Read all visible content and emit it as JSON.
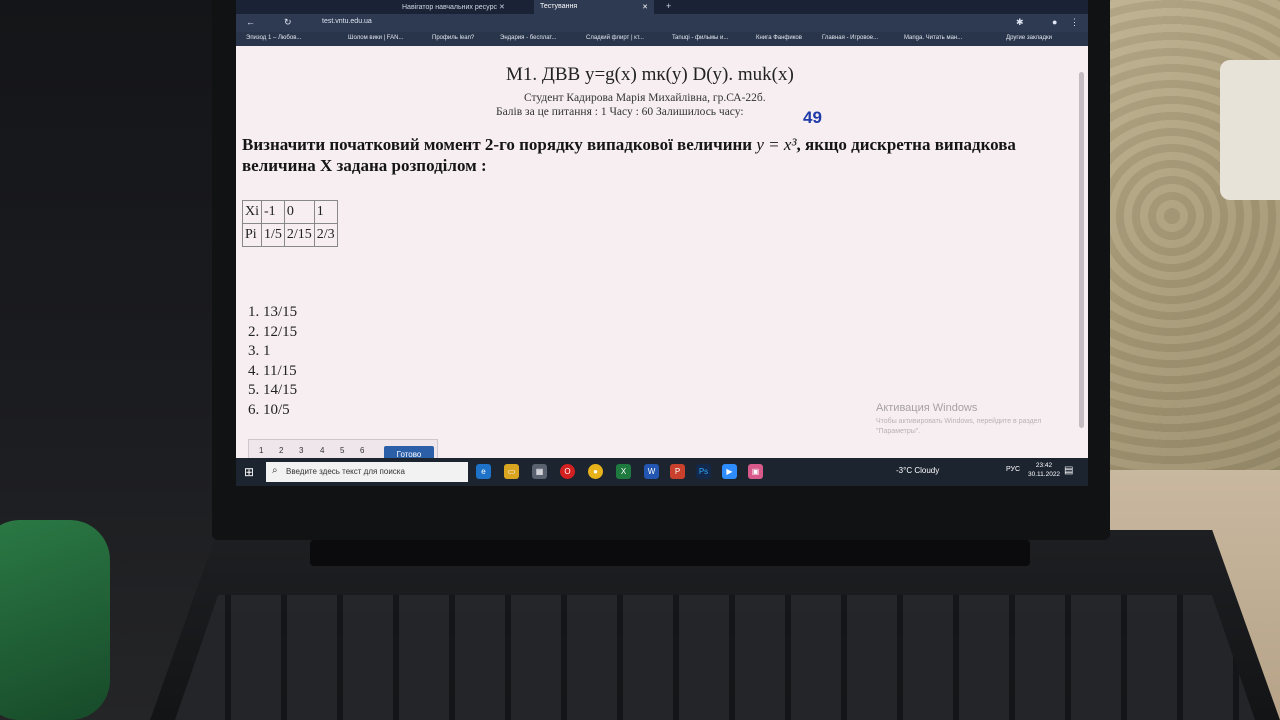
{
  "browser": {
    "tabs": [
      {
        "label": "Навігатор навчальних ресурс"
      },
      {
        "label": "Тестування"
      }
    ],
    "new_tab_symbol": "+",
    "url": "test.vntu.edu.ua",
    "bookmarks": [
      "Эпизод 1 – Любов...",
      "Шолом вики | FAN...",
      "Профиль lean?",
      "Эндария - бесплат...",
      "Сладкий флирт | кт...",
      "Tanuqi - фильмы и...",
      "Книга Фанфиков",
      "Главная - Игровое...",
      "Manga. Читать ман...",
      "Другие закладки"
    ]
  },
  "test": {
    "title": "М1. ДВВ y=g(x) mк(y) D(y). muk(x)",
    "student": "Студент Кадирова Марія Михайлівна, гр.СА-22б.",
    "time_line": "Балів за це питання : 1 Часу : 60 Залишилось часу:",
    "time_left": "49",
    "question_part1": "Визначити початковий момент 2-го порядку випадкової величини",
    "question_formula": "y = x³",
    "question_part2": ", якщо дискретна випадкова величина X задана розподілом :",
    "table": {
      "row1_label": "Xi",
      "row1_values": [
        "-1",
        "0",
        "1"
      ],
      "row2_label": "Pi",
      "row2_values": [
        "1/5",
        "2/15",
        "2/3"
      ]
    },
    "answers": [
      "1. 13/15",
      "2. 12/15",
      "3. 1",
      "4. 11/15",
      "5. 14/15",
      "6. 10/5"
    ],
    "pages": [
      "1",
      "2",
      "3",
      "4",
      "5",
      "6"
    ],
    "done_label": "Готово"
  },
  "watermark": {
    "title": "Активация Windows",
    "subtitle": "Чтобы активировать Windows, перейдите в раздел \"Параметры\"."
  },
  "taskbar": {
    "search_placeholder": "Введите здесь текст для поиска",
    "weather": "-3°C Cloudy",
    "lang": "РУС",
    "time": "23:42",
    "date": "30.11.2022"
  }
}
